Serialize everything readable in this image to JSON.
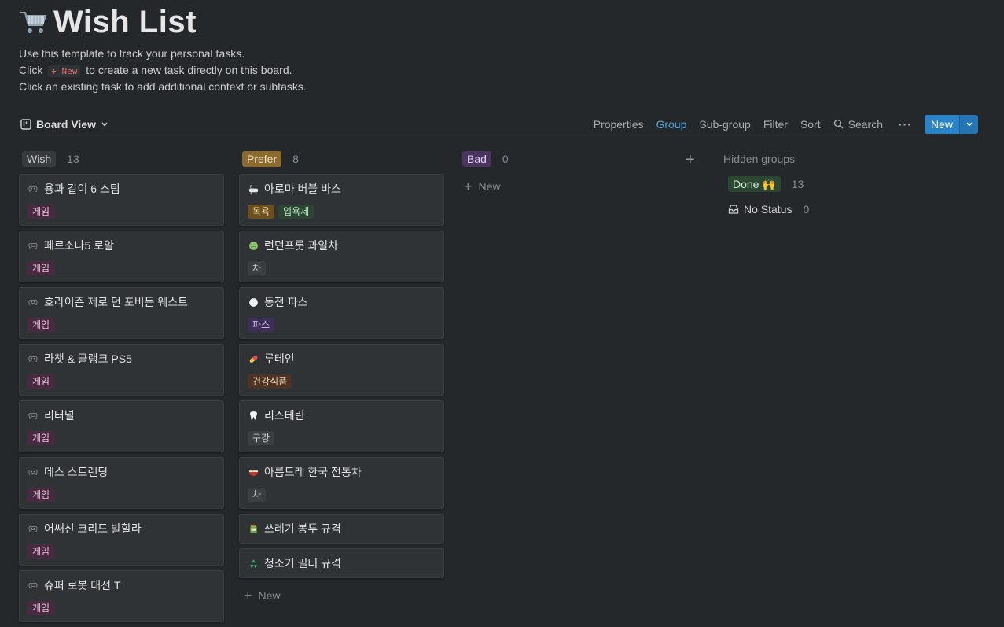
{
  "page": {
    "title": "Wish List",
    "description": [
      "Use this template to track your personal tasks.",
      "to create a new task directly on this board.",
      "Click an existing task to add additional context or subtasks."
    ],
    "desc_click": "Click",
    "desc_code": "+ New"
  },
  "toolbar": {
    "view": "Board View",
    "properties": "Properties",
    "group": "Group",
    "subgroup": "Sub-group",
    "filter": "Filter",
    "sort": "Sort",
    "search": "Search",
    "more": "···",
    "new": "New"
  },
  "columns": [
    {
      "name": "Wish",
      "count": "13",
      "pill_bg": "#373b3e",
      "pill_fg": "#d0d0d0",
      "cards": [
        {
          "title": "용과 같이 6 스팀",
          "icon": "controller-icon",
          "tags": [
            {
              "label": "게임",
              "bg": "#4a2a40",
              "fg": "#e8c3dc"
            }
          ]
        },
        {
          "title": "페르소나5 로얄",
          "icon": "controller-icon",
          "tags": [
            {
              "label": "게임",
              "bg": "#4a2a40",
              "fg": "#e8c3dc"
            }
          ]
        },
        {
          "title": "호라이즌 제로 던 포비든 웨스트",
          "icon": "controller-icon",
          "tags": [
            {
              "label": "게임",
              "bg": "#4a2a40",
              "fg": "#e8c3dc"
            }
          ]
        },
        {
          "title": "라챗 & 클랭크 PS5",
          "icon": "controller-icon",
          "tags": [
            {
              "label": "게임",
              "bg": "#4a2a40",
              "fg": "#e8c3dc"
            }
          ]
        },
        {
          "title": "리터널",
          "icon": "controller-icon",
          "tags": [
            {
              "label": "게임",
              "bg": "#4a2a40",
              "fg": "#e8c3dc"
            }
          ]
        },
        {
          "title": "데스 스트랜딩",
          "icon": "controller-icon",
          "tags": [
            {
              "label": "게임",
              "bg": "#4a2a40",
              "fg": "#e8c3dc"
            }
          ]
        },
        {
          "title": "어쌔신 크리드 발할라",
          "icon": "controller-icon",
          "tags": [
            {
              "label": "게임",
              "bg": "#4a2a40",
              "fg": "#e8c3dc"
            }
          ]
        },
        {
          "title": "슈퍼 로봇 대전 T",
          "icon": "controller-icon",
          "tags": [
            {
              "label": "게임",
              "bg": "#4a2a40",
              "fg": "#e8c3dc"
            }
          ]
        }
      ]
    },
    {
      "name": "Prefer",
      "count": "8",
      "pill_bg": "#8a6a2f",
      "pill_fg": "#f2e2c2",
      "cards": [
        {
          "title": "아로마 버블 바스",
          "icon": "bathtub-icon",
          "tags": [
            {
              "label": "목욕",
              "bg": "#6b4f1f",
              "fg": "#f1d9a8"
            },
            {
              "label": "입욕제",
              "bg": "#2b4631",
              "fg": "#bfe3c5"
            }
          ]
        },
        {
          "title": "런던프룻 과일차",
          "icon": "melon-icon",
          "tags": [
            {
              "label": "차",
              "bg": "#3b3f42",
              "fg": "#d4d4d4"
            }
          ]
        },
        {
          "title": "동전 파스",
          "icon": "circle-icon",
          "tags": [
            {
              "label": "파스",
              "bg": "#3e2f57",
              "fg": "#d7c9f0"
            }
          ]
        },
        {
          "title": "루테인",
          "icon": "pill-icon",
          "tags": [
            {
              "label": "건강식품",
              "bg": "#4d3323",
              "fg": "#efcfb8"
            }
          ]
        },
        {
          "title": "리스테린",
          "icon": "tooth-icon",
          "tags": [
            {
              "label": "구강",
              "bg": "#3b3f42",
              "fg": "#d4d4d4"
            }
          ]
        },
        {
          "title": "아름드레 한국 전통차",
          "icon": "bowl-icon",
          "tags": [
            {
              "label": "차",
              "bg": "#3b3f42",
              "fg": "#d4d4d4"
            }
          ]
        },
        {
          "title": "쓰레기 봉투 규격",
          "icon": "jar-icon",
          "tags": []
        },
        {
          "title": "청소기 필터 규격",
          "icon": "recycle-icon",
          "tags": []
        }
      ]
    },
    {
      "name": "Bad",
      "count": "0",
      "pill_bg": "#4a3560",
      "pill_fg": "#e0d0f2",
      "cards": []
    }
  ],
  "new_label": "New",
  "hidden": {
    "title": "Hidden groups",
    "items": [
      {
        "label": "Done 🙌",
        "count": "13",
        "bg": "#2b4631",
        "fg": "#cfe9d4"
      },
      {
        "label": "No Status",
        "count": "0"
      }
    ]
  }
}
